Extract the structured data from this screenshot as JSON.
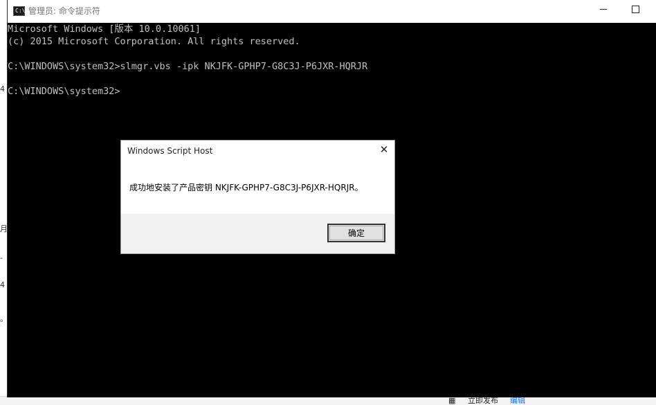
{
  "window": {
    "title": "管理员: 命令提示符",
    "icon": "cmd-icon",
    "icon_text": "C:\\"
  },
  "terminal": {
    "lines": [
      "Microsoft Windows [版本 10.0.10061]",
      "(c) 2015 Microsoft Corporation. All rights reserved.",
      "",
      "C:\\WINDOWS\\system32>slmgr.vbs -ipk NKJFK-GPHP7-G8C3J-P6JXR-HQRJR",
      "",
      "C:\\WINDOWS\\system32>"
    ]
  },
  "dialog": {
    "title": "Windows Script Host",
    "close_glyph": "✕",
    "message": "成功地安装了产品密钥 NKJFK-GPHP7-G8C3J-P6JXR-HQRJR。",
    "ok_label": "确定"
  },
  "background": {
    "left_fragments": [
      "4",
      "月",
      "-",
      "4",
      "。"
    ],
    "bottom_text": "立即发布",
    "bottom_link": "编辑"
  },
  "colors": {
    "console_bg": "#000000",
    "console_text": "#c0c0c0",
    "dialog_footer": "#f0f0f0"
  }
}
